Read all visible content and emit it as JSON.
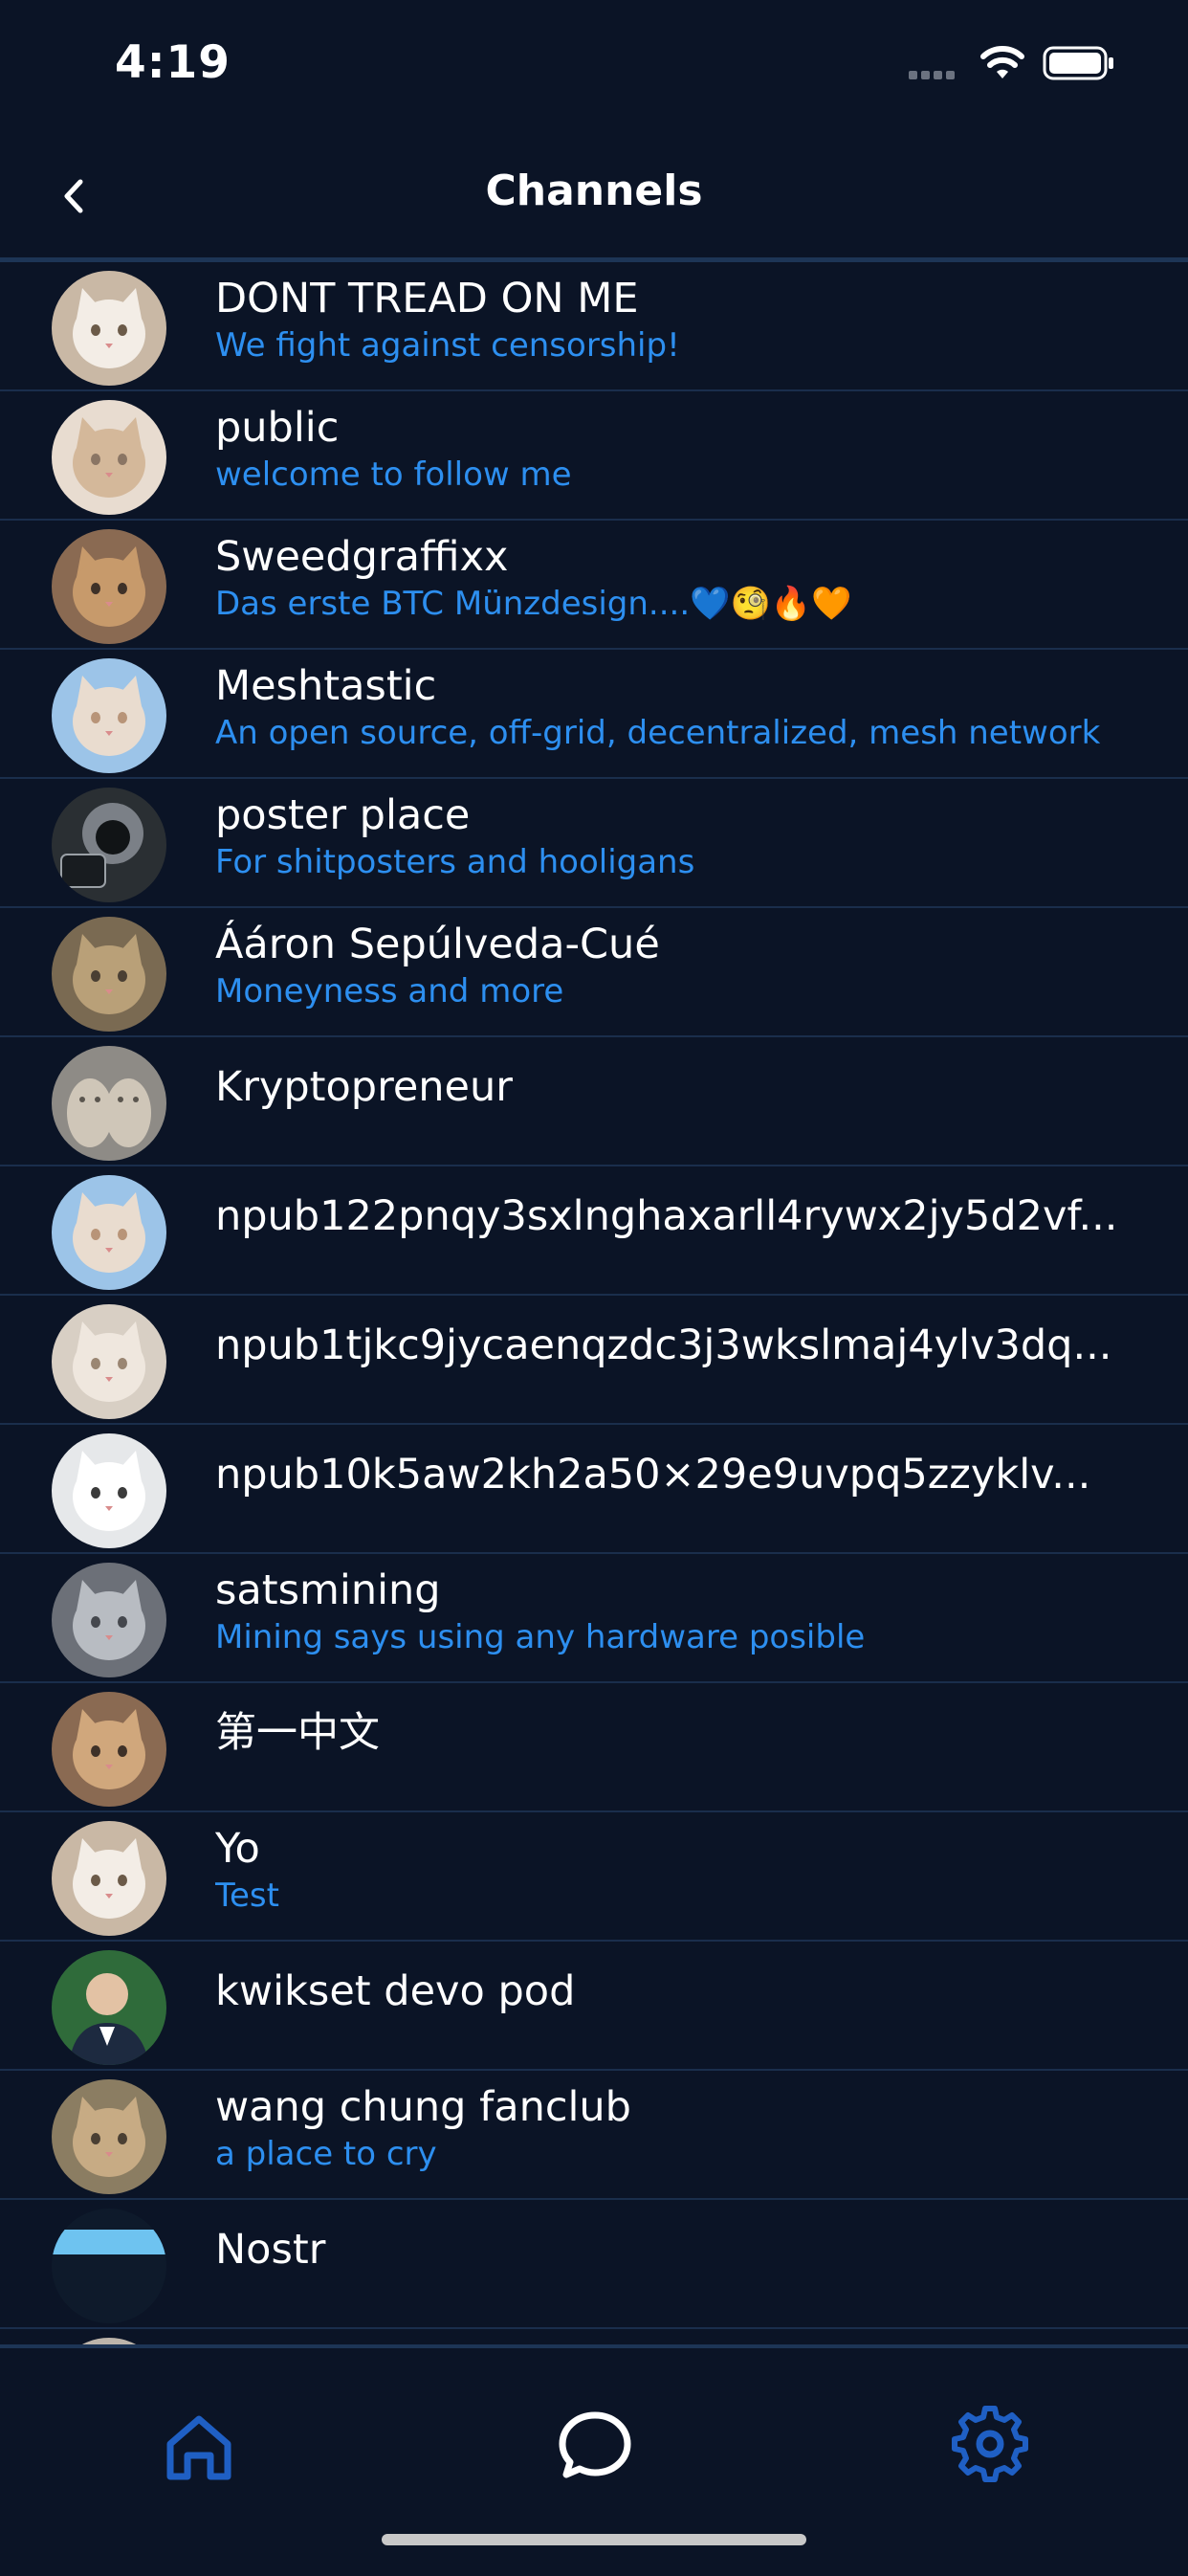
{
  "status_bar": {
    "time": "4:19"
  },
  "nav": {
    "title": "Channels"
  },
  "channels": [
    {
      "name": "DONT TREAD ON ME",
      "description": "We fight against censorship!",
      "avatar_icon": "kitten-avatar"
    },
    {
      "name": "public",
      "description": "welcome to follow me",
      "avatar_icon": "kitten-avatar"
    },
    {
      "name": "Sweedgraffixx",
      "description": "Das erste BTC Münzdesign....💙🧐🔥🧡",
      "avatar_icon": "kitten-avatar"
    },
    {
      "name": "Meshtastic",
      "description": "An open source, off-grid, decentralized, mesh network",
      "avatar_icon": "kitten-avatar"
    },
    {
      "name": "poster place",
      "description": "For shitposters and hooligans",
      "avatar_icon": "lion-avatar"
    },
    {
      "name": "Ááron Sepúlveda-Cué",
      "description": "Moneyness and more",
      "avatar_icon": "kitten-avatar"
    },
    {
      "name": "Kryptopreneur",
      "description": "",
      "avatar_icon": "kittens-avatar"
    },
    {
      "name": "npub122pnqy3sxlnghaxarll4rywx2jy5d2vf...",
      "description": "",
      "avatar_icon": "kitten-avatar"
    },
    {
      "name": "npub1tjkc9jycaenqzdc3j3wkslmaj4ylv3dq...",
      "description": "",
      "avatar_icon": "kitten-avatar"
    },
    {
      "name": "npub10k5aw2kh2a50×29e9uvpq5zzyklv...",
      "description": "",
      "avatar_icon": "kitten-avatar"
    },
    {
      "name": "satsmining",
      "description": "Mining says using any hardware posible",
      "avatar_icon": "kitten-avatar"
    },
    {
      "name": "第一中文",
      "description": "",
      "avatar_icon": "kitten-avatar"
    },
    {
      "name": "Yo",
      "description": "Test",
      "avatar_icon": "kitten-avatar"
    },
    {
      "name": "kwikset devo pod",
      "description": "",
      "avatar_icon": "person-avatar"
    },
    {
      "name": "wang chung fanclub",
      "description": "a place to cry",
      "avatar_icon": "kitten-avatar"
    },
    {
      "name": "Nostr",
      "description": "",
      "avatar_icon": "banner-avatar"
    },
    {
      "name": "",
      "description": "",
      "avatar_icon": "kitten-avatar"
    }
  ],
  "tab_bar": {
    "tabs": [
      {
        "icon": "home-icon",
        "active": false
      },
      {
        "icon": "chat-bubble-icon",
        "active": true
      },
      {
        "icon": "gear-icon",
        "active": false
      }
    ]
  },
  "colors": {
    "background": "#0b1426",
    "accent": "#2d8ff0",
    "divider": "#1a2e4c",
    "inactive_tab": "#1f5fc4"
  }
}
